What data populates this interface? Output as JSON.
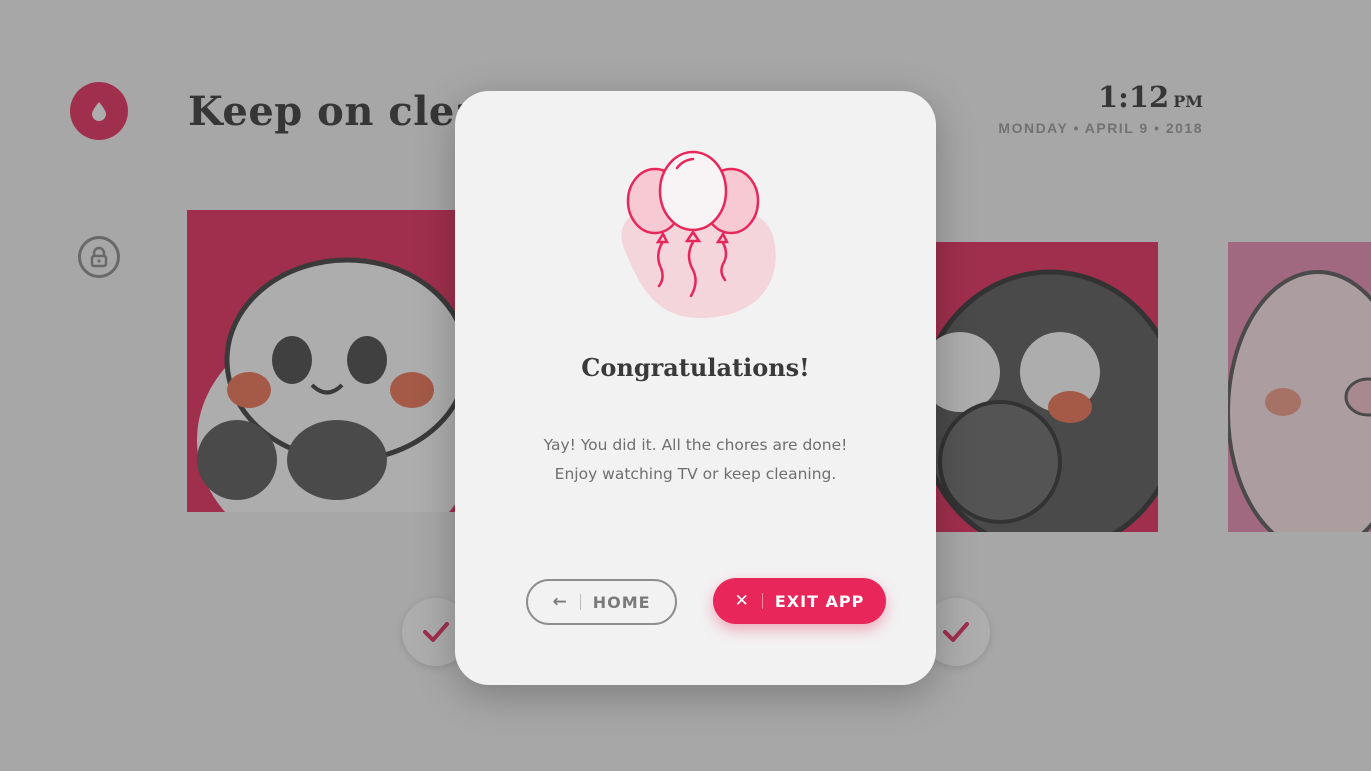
{
  "header": {
    "title": "Keep on cleaning",
    "time": "1:12",
    "ampm": "PM",
    "date": "MONDAY • APRIL 9 • 2018"
  },
  "sidebar": {
    "logo_icon": "drop-icon",
    "lock_icon": "lock-icon"
  },
  "modal": {
    "illustration": "balloons-icon",
    "title": "Congratulations!",
    "message_line1": "Yay! You did it. All the chores are done!",
    "message_line2": "Enjoy watching TV or keep cleaning.",
    "home_button": {
      "icon": "←",
      "label": "HOME"
    },
    "exit_button": {
      "icon": "✕",
      "label": "EXIT APP"
    }
  },
  "colors": {
    "accent": "#e8265a",
    "modal_bg": "#f2f2f2",
    "balloon_fill": "#f6c9d3",
    "blob": "#f5d5dc"
  }
}
